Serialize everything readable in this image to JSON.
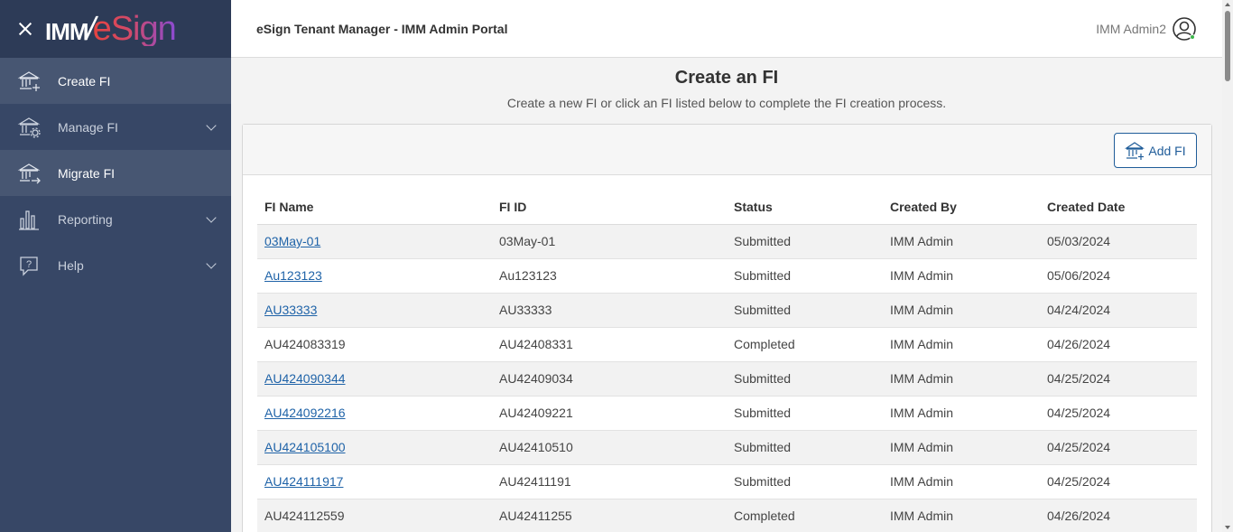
{
  "brand": {
    "logo_left": "IMM",
    "logo_slash": "/",
    "logo_right": "eSign",
    "close_icon": "close-icon"
  },
  "sidebar": {
    "items": [
      {
        "label": "Create FI",
        "icon": "bank-add-icon",
        "active": true,
        "expandable": false
      },
      {
        "label": "Manage FI",
        "icon": "bank-gear-icon",
        "active": false,
        "expandable": true
      },
      {
        "label": "Migrate FI",
        "icon": "bank-migrate-icon",
        "active": true,
        "expandable": false
      },
      {
        "label": "Reporting",
        "icon": "bar-chart-icon",
        "active": false,
        "expandable": true
      },
      {
        "label": "Help",
        "icon": "help-icon",
        "active": false,
        "expandable": true
      }
    ]
  },
  "header": {
    "title": "eSign Tenant Manager - IMM Admin Portal",
    "user_name": "IMM Admin2"
  },
  "main": {
    "title": "Create an FI",
    "subtitle": "Create a new FI or click an FI listed below to complete the FI creation process.",
    "add_button_label": "Add FI"
  },
  "table": {
    "columns": [
      "FI Name",
      "FI ID",
      "Status",
      "Created By",
      "Created Date"
    ],
    "rows": [
      {
        "name": "03May-01",
        "id": "03May-01",
        "status": "Submitted",
        "created_by": "IMM Admin",
        "date": "05/03/2024",
        "link": true
      },
      {
        "name": "Au123123",
        "id": "Au123123",
        "status": "Submitted",
        "created_by": "IMM Admin",
        "date": "05/06/2024",
        "link": true
      },
      {
        "name": "AU33333",
        "id": "AU33333",
        "status": "Submitted",
        "created_by": "IMM Admin",
        "date": "04/24/2024",
        "link": true
      },
      {
        "name": "AU424083319",
        "id": "AU42408331",
        "status": "Completed",
        "created_by": "IMM Admin",
        "date": "04/26/2024",
        "link": false
      },
      {
        "name": "AU424090344",
        "id": "AU42409034",
        "status": "Submitted",
        "created_by": "IMM Admin",
        "date": "04/25/2024",
        "link": true
      },
      {
        "name": "AU424092216",
        "id": "AU42409221",
        "status": "Submitted",
        "created_by": "IMM Admin",
        "date": "04/25/2024",
        "link": true
      },
      {
        "name": "AU424105100",
        "id": "AU42410510",
        "status": "Submitted",
        "created_by": "IMM Admin",
        "date": "04/25/2024",
        "link": true
      },
      {
        "name": "AU424111917",
        "id": "AU42411191",
        "status": "Submitted",
        "created_by": "IMM Admin",
        "date": "04/25/2024",
        "link": true
      },
      {
        "name": "AU424112559",
        "id": "AU42411255",
        "status": "Completed",
        "created_by": "IMM Admin",
        "date": "04/26/2024",
        "link": false
      }
    ]
  },
  "colors": {
    "sidebar": "#374766",
    "brand_bar": "#2d3b57",
    "link": "#1f63a8",
    "accent": "#1f5c99"
  }
}
